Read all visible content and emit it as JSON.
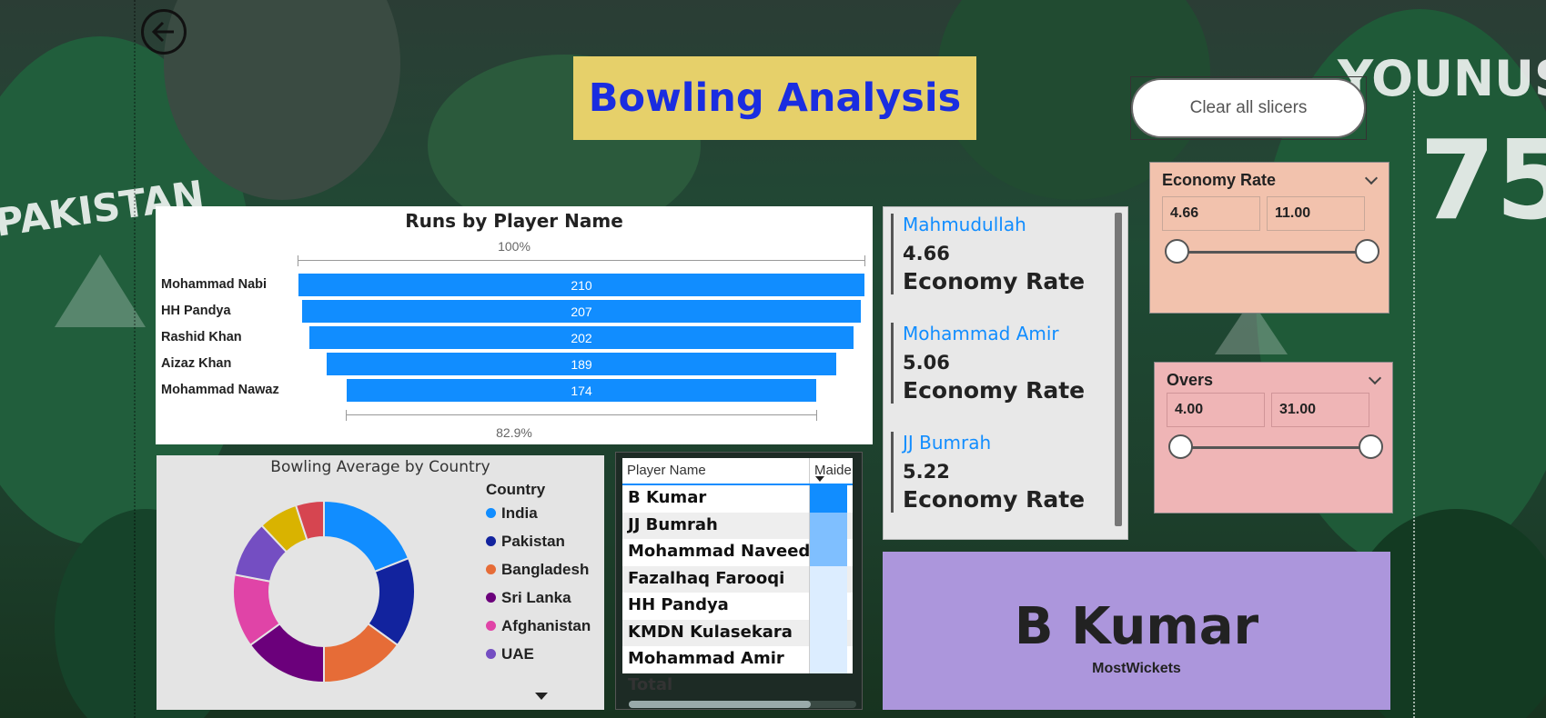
{
  "page_title": "Bowling Analysis",
  "clear_button_label": "Clear all slicers",
  "background_text": {
    "left_jersey": "PAKISTAN",
    "right_jersey_name": "YOUNUS",
    "right_jersey_number": "75"
  },
  "funnel": {
    "title": "Runs by Player Name",
    "top_pct": "100%",
    "bottom_pct": "82.9%",
    "rows": [
      {
        "label": "Mohammad Nabi",
        "value": "210"
      },
      {
        "label": "HH Pandya",
        "value": "207"
      },
      {
        "label": "Rashid Khan",
        "value": "202"
      },
      {
        "label": "Aizaz Khan",
        "value": "189"
      },
      {
        "label": "Mohammad Nawaz",
        "value": "174"
      }
    ]
  },
  "donut": {
    "title": "Bowling Average by Country",
    "legend_title": "Country",
    "legend": [
      {
        "name": "India",
        "color": "#118dff"
      },
      {
        "name": "Pakistan",
        "color": "#12239e"
      },
      {
        "name": "Bangladesh",
        "color": "#e66c37"
      },
      {
        "name": "Sri Lanka",
        "color": "#6b007b"
      },
      {
        "name": "Afghanistan",
        "color": "#e044a7"
      },
      {
        "name": "UAE",
        "color": "#744ec2"
      }
    ],
    "slice_shares": [
      {
        "color": "#118dff",
        "share": 0.19
      },
      {
        "color": "#12239e",
        "share": 0.16
      },
      {
        "color": "#e66c37",
        "share": 0.15
      },
      {
        "color": "#6b007b",
        "share": 0.15
      },
      {
        "color": "#e044a7",
        "share": 0.13
      },
      {
        "color": "#744ec2",
        "share": 0.1
      },
      {
        "color": "#d9b300",
        "share": 0.07
      },
      {
        "color": "#d64550",
        "share": 0.05
      }
    ]
  },
  "table": {
    "col1": "Player Name",
    "col2": "Maide",
    "rows": [
      {
        "name": "B Kumar",
        "shade": "#118dff"
      },
      {
        "name": "JJ Bumrah",
        "shade": "#7fbfff"
      },
      {
        "name": "Mohammad Naveed",
        "shade": "#7fbfff"
      },
      {
        "name": "Fazalhaq Farooqi",
        "shade": "#dcedff"
      },
      {
        "name": "HH Pandya",
        "shade": "#dcedff"
      },
      {
        "name": "KMDN Kulasekara",
        "shade": "#dcedff"
      },
      {
        "name": "Mohammad Amir",
        "shade": "#dcedff"
      }
    ],
    "total_label": "Total"
  },
  "multi_card": [
    {
      "name": "Mahmudullah",
      "value": "4.66",
      "label": "Economy Rate"
    },
    {
      "name": "Mohammad Amir",
      "value": "5.06",
      "label": "Economy Rate"
    },
    {
      "name": "JJ Bumrah",
      "value": "5.22",
      "label": "Economy Rate"
    }
  ],
  "economy_slicer": {
    "title": "Economy Rate",
    "min": "4.66",
    "max": "11.00"
  },
  "overs_slicer": {
    "title": "Overs",
    "min": "4.00",
    "max": "31.00"
  },
  "kpi": {
    "value": "B Kumar",
    "label": "MostWickets"
  }
}
